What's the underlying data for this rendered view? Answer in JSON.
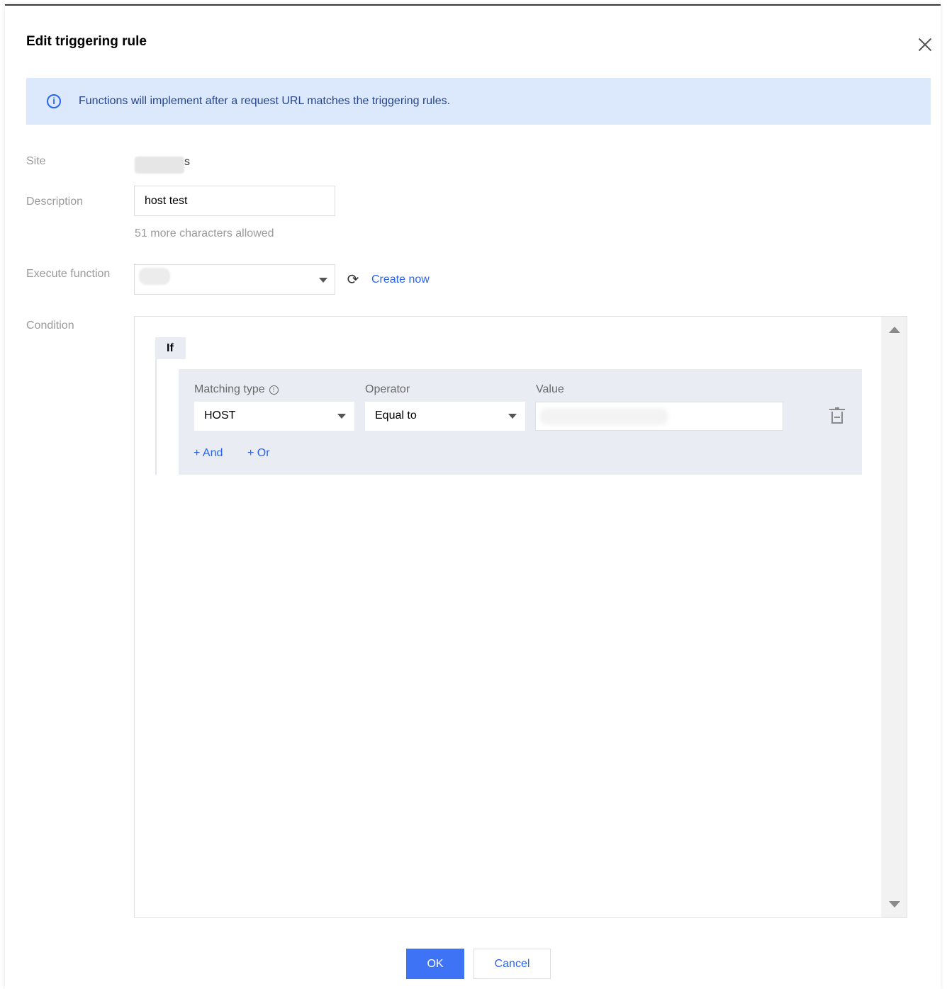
{
  "dialog": {
    "title": "Edit triggering rule"
  },
  "notice": {
    "text": "Functions will implement after a request URL matches the triggering rules."
  },
  "form": {
    "site_label": "Site",
    "site_value": "s",
    "description_label": "Description",
    "description_value": "host test",
    "description_hint": "51 more characters allowed",
    "execute_label": "Execute function",
    "create_now": "Create now",
    "condition_label": "Condition"
  },
  "condition": {
    "if_label": "If",
    "columns": {
      "matching_type": "Matching type",
      "operator": "Operator",
      "value": "Value"
    },
    "rule": {
      "matching_type": "HOST",
      "operator": "Equal to"
    },
    "add_and": "+ And",
    "add_or": "+ Or"
  },
  "footer": {
    "ok": "OK",
    "cancel": "Cancel"
  },
  "colors": {
    "accent": "#3f73f5",
    "link": "#2a63ee",
    "notice_bg": "#dce9fd"
  }
}
